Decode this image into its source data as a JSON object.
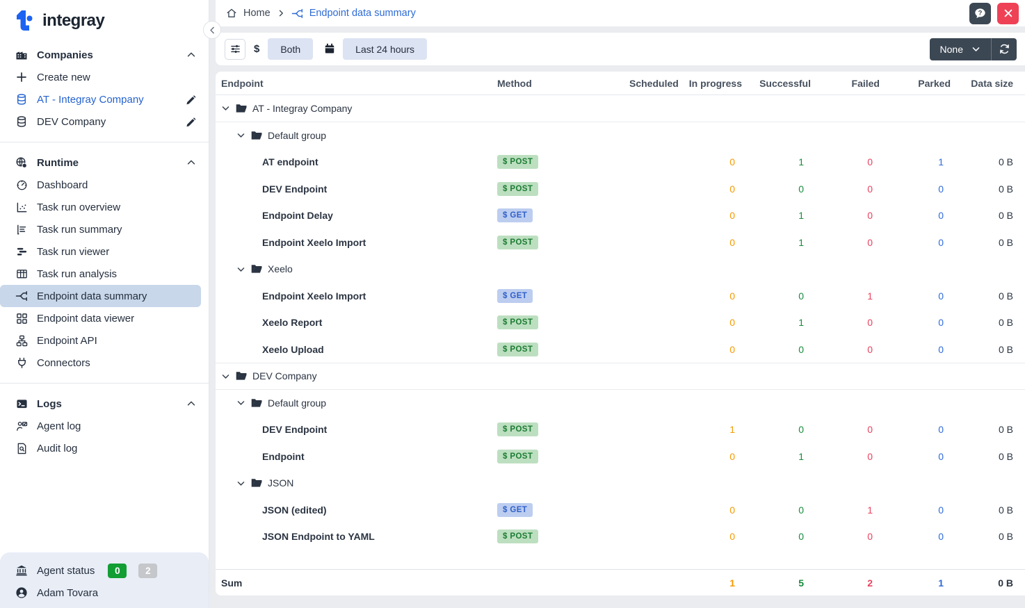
{
  "app": {
    "name": "integray"
  },
  "colors": {
    "accent_blue": "#2e6bd6",
    "logo_blue": "#1c63f2",
    "dark_text": "#252f3e",
    "selected_item_bg": "#c8d7ea",
    "page_bg": "#eaecef",
    "card_border": "#e4e7ec",
    "orange": "#f59a00",
    "green": "#178c3c",
    "red": "#e84360",
    "blue": "#2f6cd8",
    "post_badge_bg": "#bcdfc0",
    "post_badge_text": "#1d7c33",
    "get_badge_bg": "#bccdf0",
    "get_badge_text": "#3060c8",
    "dark_button": "#3c4754",
    "close_red": "#ee4156",
    "footer_bg": "#e8edf6",
    "status_green": "#129e33",
    "status_gray": "#c5c7cb",
    "chip_bg": "#dce3f2"
  },
  "sidebar": {
    "sections": [
      {
        "label": "Companies",
        "items": [
          {
            "label": "Create new"
          },
          {
            "label": "AT - Integray Company"
          },
          {
            "label": "DEV Company"
          }
        ]
      },
      {
        "label": "Runtime",
        "items": [
          {
            "label": "Dashboard"
          },
          {
            "label": "Task run overview"
          },
          {
            "label": "Task run summary"
          },
          {
            "label": "Task run viewer"
          },
          {
            "label": "Task run analysis"
          },
          {
            "label": "Endpoint data summary"
          },
          {
            "label": "Endpoint data viewer"
          },
          {
            "label": "Endpoint API"
          },
          {
            "label": "Connectors"
          }
        ]
      },
      {
        "label": "Logs",
        "items": [
          {
            "label": "Agent log"
          },
          {
            "label": "Audit log"
          }
        ]
      }
    ],
    "footer": {
      "agent_status_label": "Agent status",
      "agent_ok_count": "0",
      "agent_offline_count": "2",
      "user_name": "Adam Tovara"
    }
  },
  "breadcrumb": {
    "home_label": "Home",
    "current_label": "Endpoint data summary"
  },
  "toolbar": {
    "currency_symbol": "$",
    "type_filter_value": "Both",
    "time_range_value": "Last 24 hours",
    "grouping_value": "None"
  },
  "table": {
    "columns": [
      "Endpoint",
      "Method",
      "Scheduled",
      "In progress",
      "Successful",
      "Failed",
      "Parked",
      "Data size"
    ],
    "method_prefix": "$",
    "rows": [
      {
        "type": "company",
        "name": "AT - Integray Company"
      },
      {
        "type": "group",
        "name": "Default group"
      },
      {
        "type": "endpoint",
        "name": "AT endpoint",
        "method": "POST",
        "in_progress": 0,
        "successful": 1,
        "failed": 0,
        "parked": 1,
        "data_size": "0 B"
      },
      {
        "type": "endpoint",
        "name": "DEV Endpoint",
        "method": "POST",
        "in_progress": 0,
        "successful": 0,
        "failed": 0,
        "parked": 0,
        "data_size": "0 B"
      },
      {
        "type": "endpoint",
        "name": "Endpoint Delay",
        "method": "GET",
        "in_progress": 0,
        "successful": 1,
        "failed": 0,
        "parked": 0,
        "data_size": "0 B"
      },
      {
        "type": "endpoint",
        "name": "Endpoint Xeelo Import",
        "method": "POST",
        "in_progress": 0,
        "successful": 1,
        "failed": 0,
        "parked": 0,
        "data_size": "0 B"
      },
      {
        "type": "group",
        "name": "Xeelo"
      },
      {
        "type": "endpoint",
        "name": "Endpoint Xeelo Import",
        "method": "GET",
        "in_progress": 0,
        "successful": 0,
        "failed": 1,
        "parked": 0,
        "data_size": "0 B"
      },
      {
        "type": "endpoint",
        "name": "Xeelo Report",
        "method": "POST",
        "in_progress": 0,
        "successful": 1,
        "failed": 0,
        "parked": 0,
        "data_size": "0 B"
      },
      {
        "type": "endpoint",
        "name": "Xeelo Upload",
        "method": "POST",
        "in_progress": 0,
        "successful": 0,
        "failed": 0,
        "parked": 0,
        "data_size": "0 B"
      },
      {
        "type": "company",
        "name": "DEV Company"
      },
      {
        "type": "group",
        "name": "Default group"
      },
      {
        "type": "endpoint",
        "name": "DEV Endpoint",
        "method": "POST",
        "in_progress": 1,
        "successful": 0,
        "failed": 0,
        "parked": 0,
        "data_size": "0 B"
      },
      {
        "type": "endpoint",
        "name": "Endpoint",
        "method": "POST",
        "in_progress": 0,
        "successful": 1,
        "failed": 0,
        "parked": 0,
        "data_size": "0 B"
      },
      {
        "type": "group",
        "name": "JSON"
      },
      {
        "type": "endpoint",
        "name": "JSON (edited)",
        "method": "GET",
        "in_progress": 0,
        "successful": 0,
        "failed": 1,
        "parked": 0,
        "data_size": "0 B"
      },
      {
        "type": "endpoint",
        "name": "JSON Endpoint to YAML",
        "method": "POST",
        "in_progress": 0,
        "successful": 0,
        "failed": 0,
        "parked": 0,
        "data_size": "0 B"
      }
    ],
    "sum": {
      "label": "Sum",
      "in_progress": "1",
      "successful": "5",
      "failed": "2",
      "parked": "1",
      "data_size": "0 B"
    }
  }
}
